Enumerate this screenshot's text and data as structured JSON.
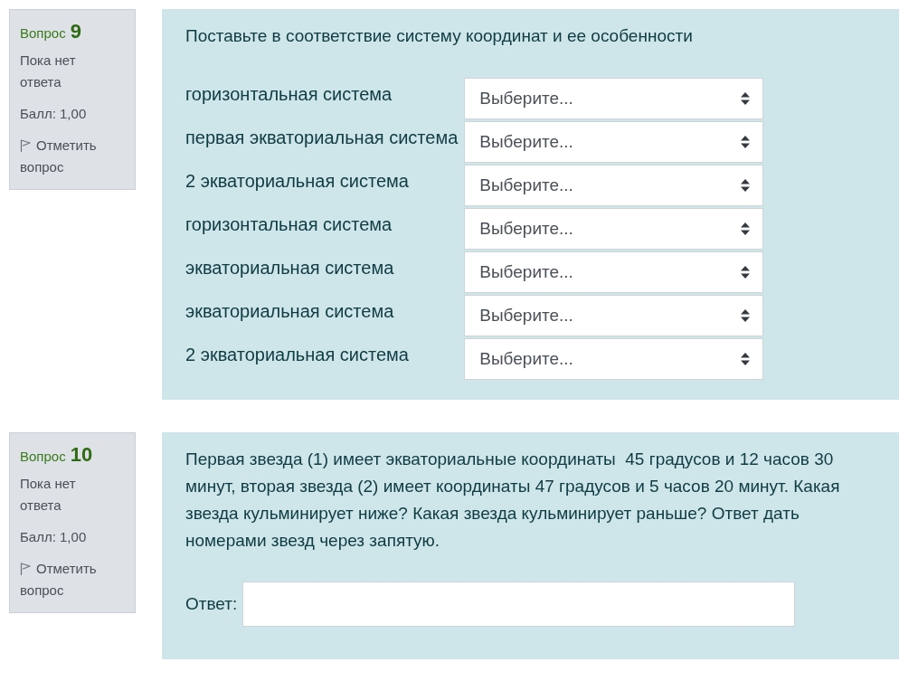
{
  "questions": [
    {
      "kind": "match",
      "info": {
        "label": "Вопрос",
        "number": "9",
        "status": "Пока нет ответа",
        "grade": "Балл: 1,00",
        "flag_link": "Отметить вопрос"
      },
      "prompt": "Поставьте в соответствие систему координат и ее особенности",
      "rows": [
        {
          "label": "горизонтальная система",
          "choice": "Выберите..."
        },
        {
          "label": "первая экваториальная система",
          "choice": "Выберите..."
        },
        {
          "label": "2 экваториальная система",
          "choice": "Выберите..."
        },
        {
          "label": "горизонтальная система",
          "choice": "Выберите..."
        },
        {
          "label": "экваториальная система",
          "choice": "Выберите..."
        },
        {
          "label": "экваториальная система",
          "choice": "Выберите..."
        },
        {
          "label": "2 экваториальная система",
          "choice": "Выберите..."
        }
      ]
    },
    {
      "kind": "shortanswer",
      "info": {
        "label": "Вопрос",
        "number": "10",
        "status": "Пока нет ответа",
        "grade": "Балл: 1,00",
        "flag_link": "Отметить вопрос"
      },
      "prompt": "Первая звезда (1) имеет экваториальные координаты  45 градусов и 12 часов 30 минут, вторая звезда (2) имеет координаты 47 градусов и 5 часов 20 минут. Какая звезда кульминирует ниже? Какая звезда кульминирует раньше? Ответ дать номерами звезд через запятую.",
      "answer": {
        "label": "Ответ:"
      }
    }
  ]
}
